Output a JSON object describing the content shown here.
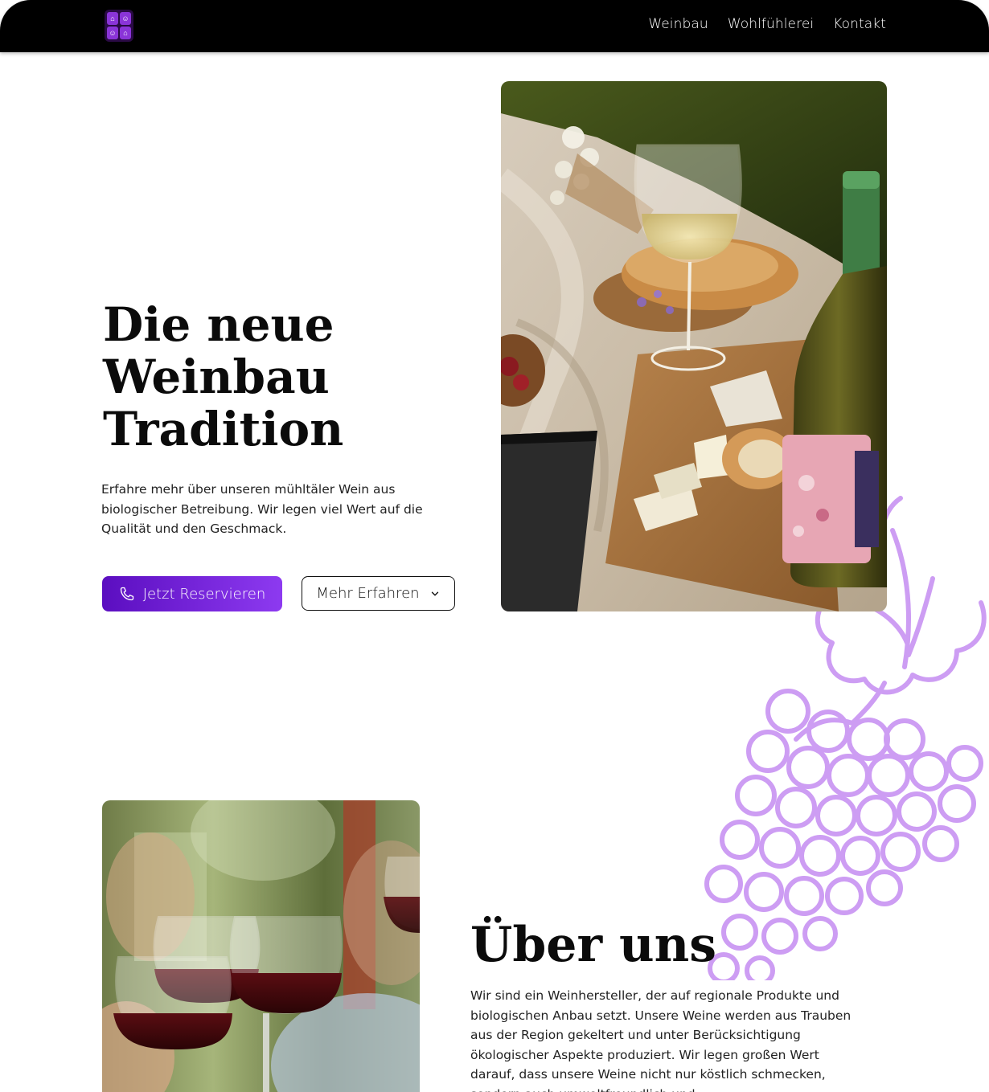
{
  "header": {
    "logo_alt": "Logo",
    "nav": [
      {
        "label": "Weinbau"
      },
      {
        "label": "Wohlfühlerei"
      },
      {
        "label": "Kontakt"
      }
    ]
  },
  "hero": {
    "title_line1": "Die neue",
    "title_line2": "Weinbau",
    "title_line3": "Tradition",
    "text": "Erfahre mehr über unseren mühltäler Wein aus biologischer Betreibung. Wir legen viel Wert auf die Qualität und den Geschmack.",
    "primary_button": "Jetzt Reservieren",
    "secondary_button": "Mehr Erfahren",
    "image_icon": "picnic-wine-photo"
  },
  "about": {
    "title": "Über uns",
    "text": "Wir sind ein Weinhersteller, der auf regionale Produkte und biologischen Anbau setzt. Unsere Weine werden aus Trauben aus der Region gekeltert und unter Berücksichtigung ökologischer Aspekte produziert. Wir legen großen Wert darauf, dass unsere Weine nicht nur köstlich schmecken, sondern auch umweltfreundlich und",
    "image_icon": "red-wine-toast-photo"
  },
  "colors": {
    "accent_start": "#5b0ec0",
    "accent_end": "#8d3af0",
    "grape_outline": "#c58cf2",
    "header_bg": "#000000"
  }
}
